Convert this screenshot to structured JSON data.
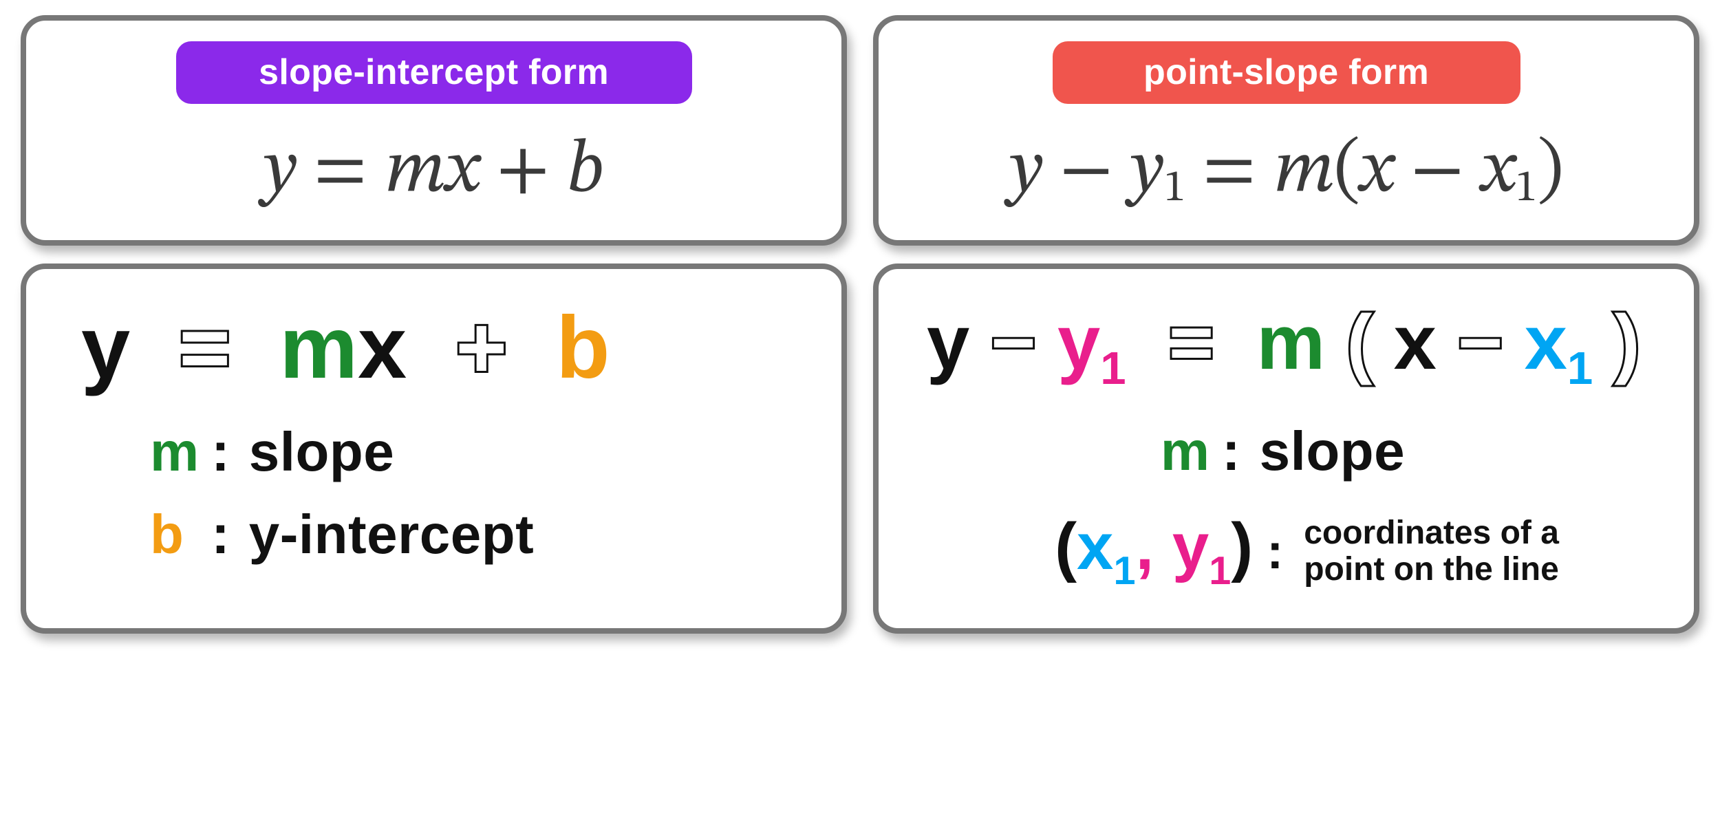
{
  "left": {
    "badge": "slope-intercept form",
    "equation_serif": "y = mx + b",
    "legend": {
      "m": "m",
      "m_desc": "slope",
      "b": "b",
      "b_desc": "y-intercept"
    }
  },
  "right": {
    "badge": "point-slope form",
    "equation_serif": "y − y₁ = m(x − x₁)",
    "equation_color_readable": "y − y₁ = m(x − x₁)",
    "legend": {
      "m": "m",
      "m_desc": "slope",
      "point": "(x₁, y₁)",
      "point_desc_line1": "coordinates of a",
      "point_desc_line2": "point on the line"
    }
  },
  "colors": {
    "purple": "#8b29ea",
    "red": "#f0554d",
    "green": "#1c8b2f",
    "orange": "#f39c12",
    "pink": "#e91e8c",
    "blue": "#00a5f3",
    "black": "#111111",
    "border": "#777777"
  }
}
